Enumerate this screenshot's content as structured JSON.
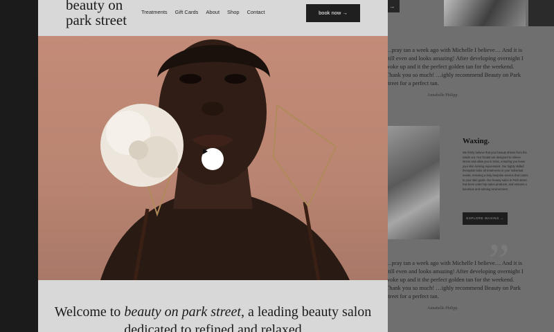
{
  "brand": {
    "logo_text": "beauty on park street"
  },
  "nav": {
    "items": [
      "Treatments",
      "Gift Cards",
      "About",
      "Shop",
      "Contact"
    ]
  },
  "header": {
    "book_label": "book now →"
  },
  "hero": {
    "play_icon": "play-icon"
  },
  "welcome": {
    "prefix": "Welcome to ",
    "brand_italic": "beauty on park street",
    "suffix": ", a leading beauty salon dedicated to refined and relaxed"
  },
  "background_site": {
    "top_button": "→",
    "testimonial_1": "…pray tan a week ago with Michelle I believe… And it is still even and looks amazing! After developing overnight I woke up and it the perfect golden tan for the weekend. Thank you so much! …ighly recommend Beauty on Park street for a perfect tan.",
    "testimonial_1_author": "Annabelle Philipp",
    "section_title": "Waxing.",
    "section_body": "We firmly believe that your beauty shines from the inside out. Our facials are designed to relieve stress and allow you to relax, ensuring you leave your skin looking rejuvenated. Our highly skilled therapists tailor all treatments to your individual needs, ensuring a truly bespoke service that caters to your skin goals. Our beauty salon in Park street has been voted top salon products, and ensures a luxurious and calming environment.",
    "section_button": "EXPLORE WAXING →",
    "testimonial_2": "…pray tan a week ago with Michelle I believe… And it is still even and looks amazing! After developing overnight I woke up and it the perfect golden tan for the weekend. Thank you so much! …ighly recommend Beauty on Park street for a perfect tan.",
    "testimonial_2_author": "Annabelle Philipp"
  },
  "colors": {
    "accent_dark": "#1f1f1f",
    "hero_bg": "#c38b78",
    "page_bg": "#d8d8d8"
  }
}
